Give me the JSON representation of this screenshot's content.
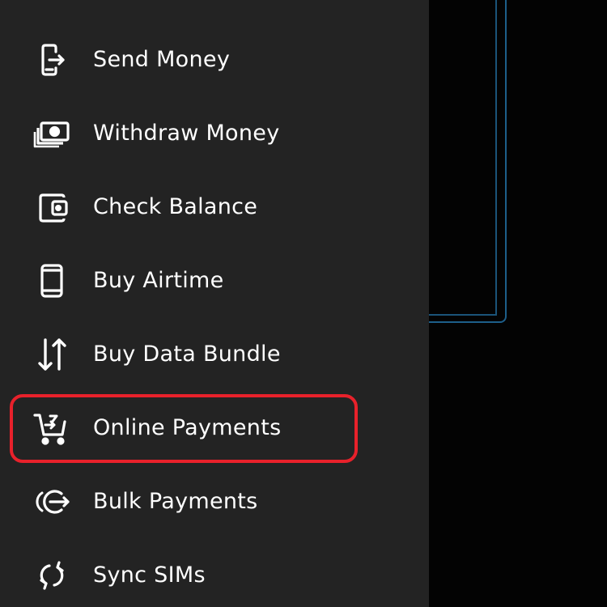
{
  "drawer": {
    "items": [
      {
        "label": "Send Money",
        "icon": "send-money-icon"
      },
      {
        "label": "Withdraw Money",
        "icon": "cash-icon"
      },
      {
        "label": "Check Balance",
        "icon": "wallet-icon"
      },
      {
        "label": "Buy Airtime",
        "icon": "phone-icon"
      },
      {
        "label": "Buy Data Bundle",
        "icon": "up-down-arrows-icon"
      },
      {
        "label": "Online Payments",
        "icon": "cart-icon"
      },
      {
        "label": "Bulk Payments",
        "icon": "bulk-payments-icon"
      },
      {
        "label": "Sync SIMs",
        "icon": "sync-icon"
      }
    ],
    "highlighted_item": "Online Payments"
  },
  "colors": {
    "drawer_background": "#232323",
    "screen_background": "#020202",
    "highlight_border": "#e8212b",
    "frame_accent": "#1d5f8a",
    "text": "#ffffff"
  }
}
